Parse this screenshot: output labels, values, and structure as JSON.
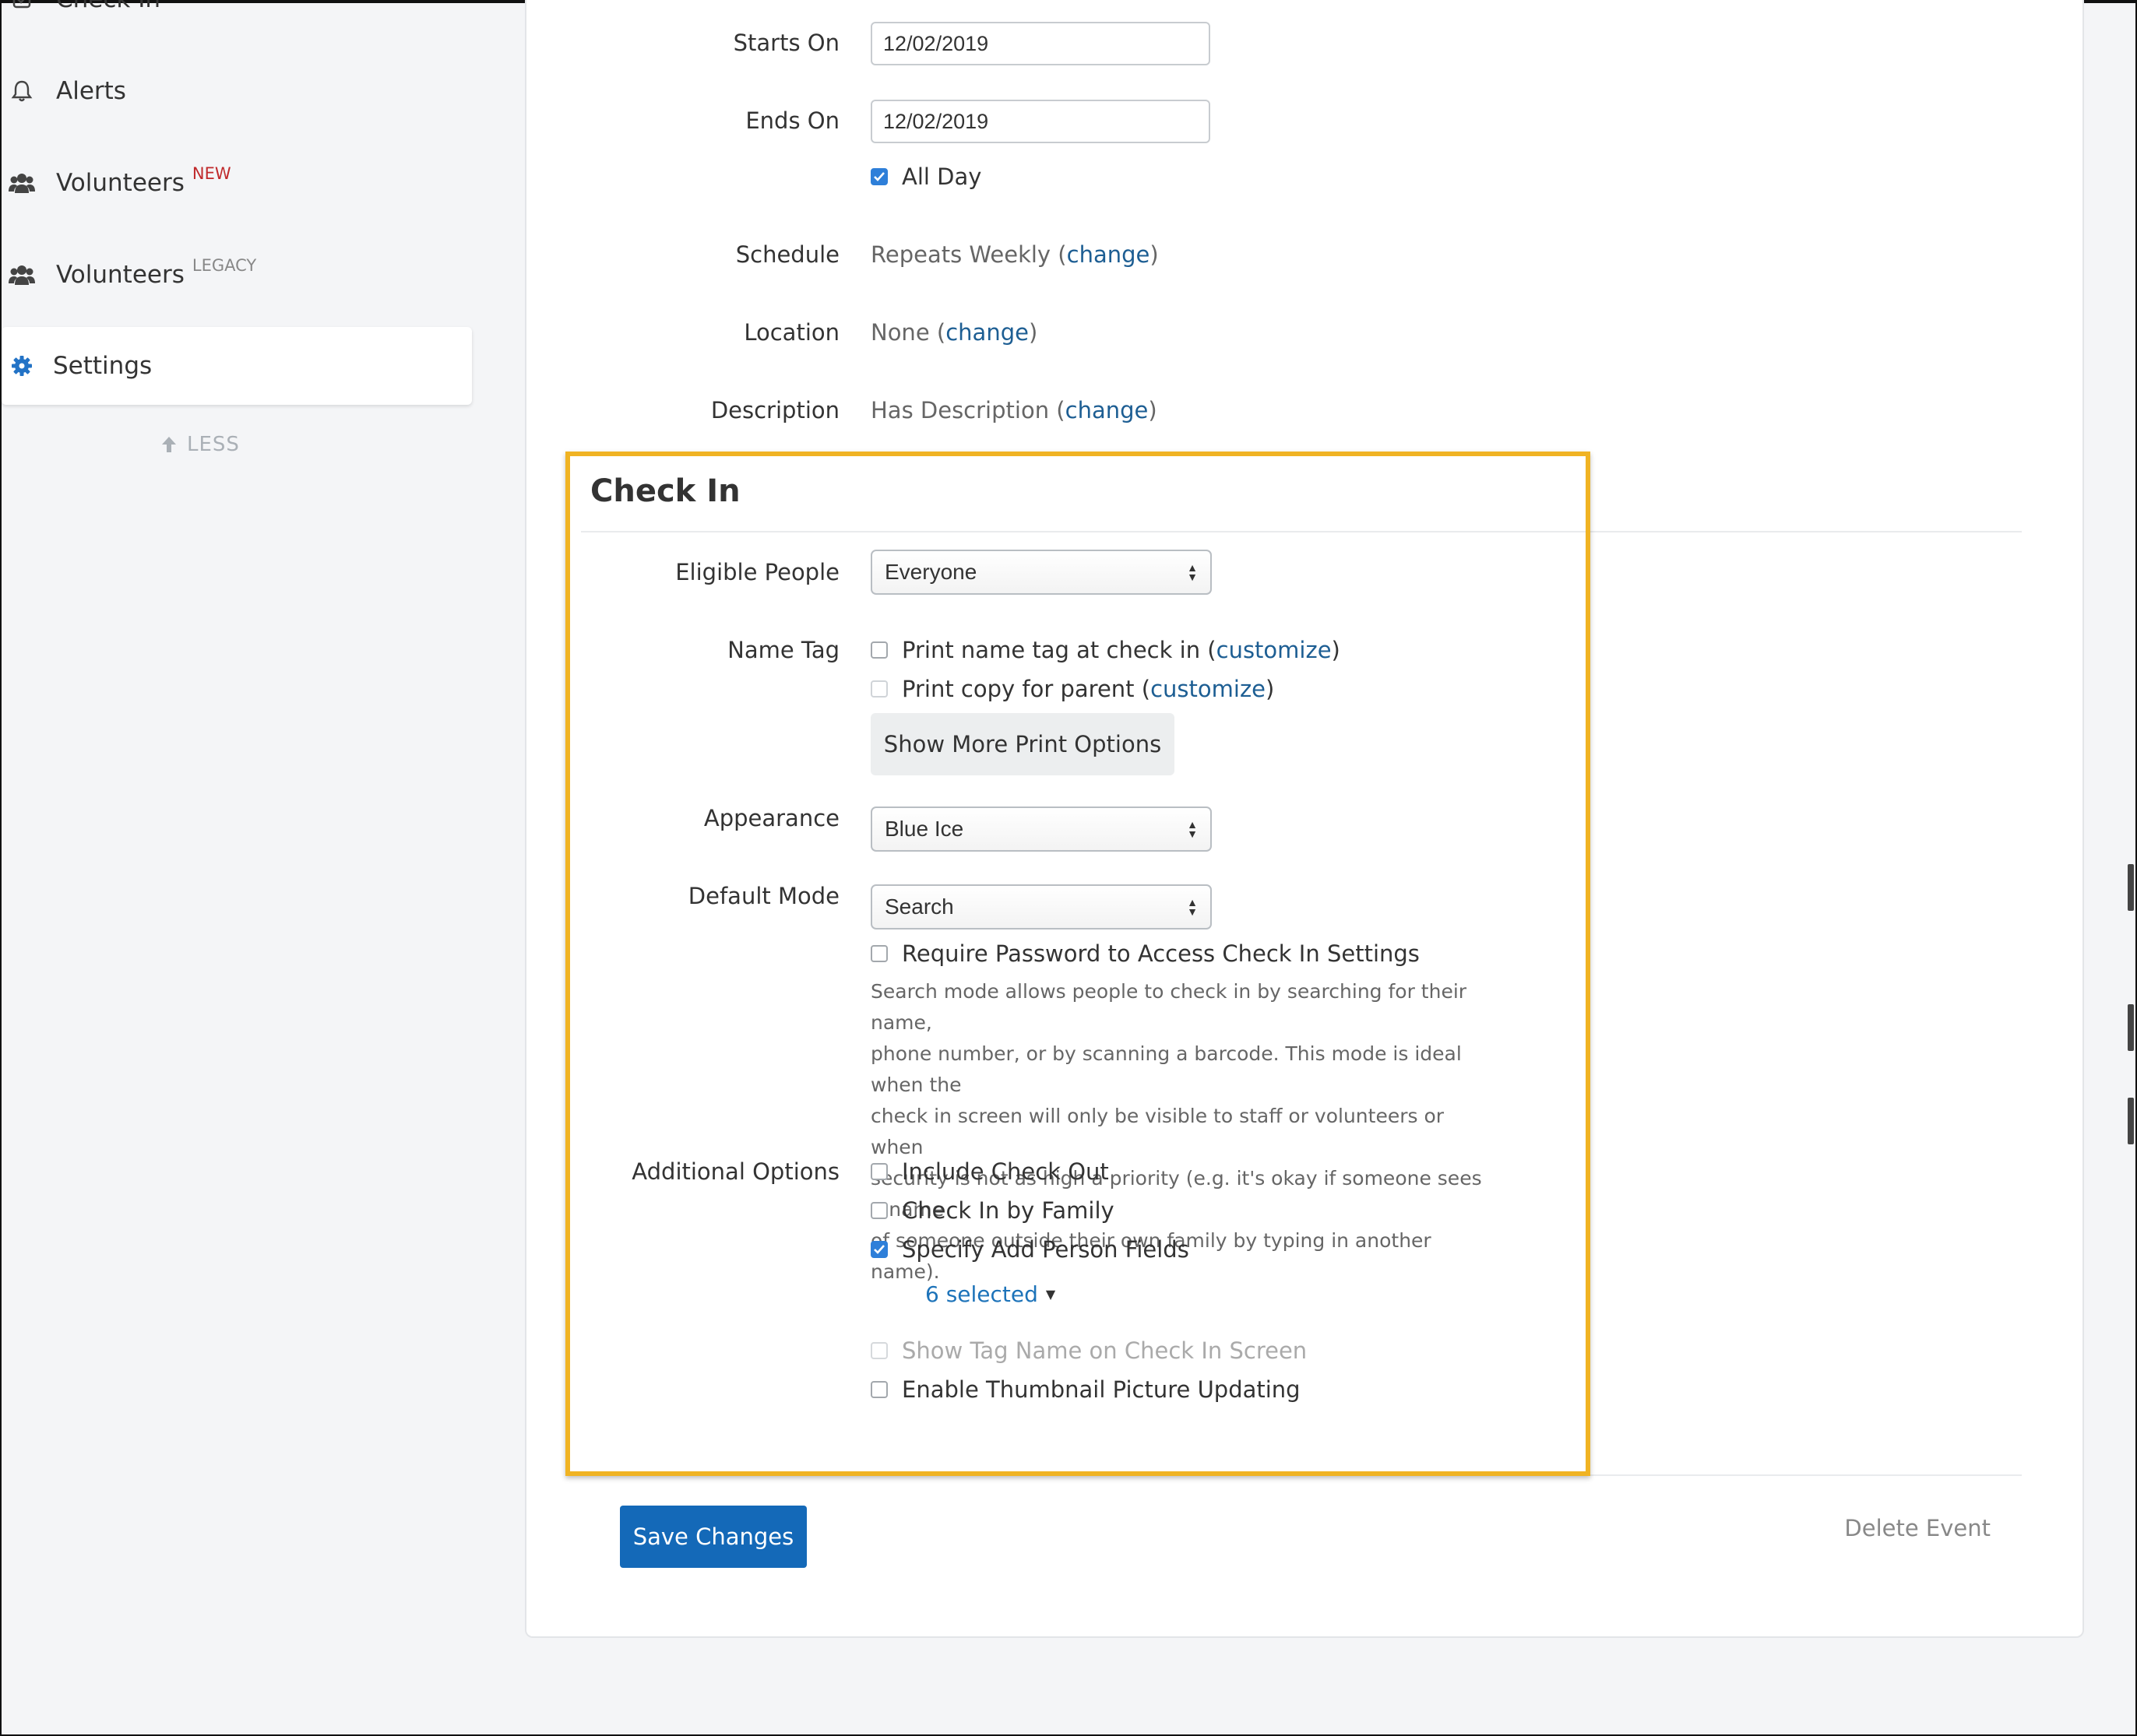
{
  "sidebar": {
    "items": [
      {
        "label": "Check In",
        "icon": "check-in-icon"
      },
      {
        "label": "Alerts",
        "icon": "bell-icon"
      },
      {
        "label": "Volunteers",
        "badge": "NEW",
        "icon": "people-icon"
      },
      {
        "label": "Volunteers",
        "badge": "LEGACY",
        "icon": "people-icon"
      },
      {
        "label": "Settings",
        "icon": "gear-icon",
        "active": true
      }
    ],
    "less_label": "LESS"
  },
  "form": {
    "starts_on": {
      "label": "Starts On",
      "value": "12/02/2019"
    },
    "ends_on": {
      "label": "Ends On",
      "value": "12/02/2019"
    },
    "all_day": {
      "label": "All Day",
      "checked": true
    },
    "schedule": {
      "label": "Schedule",
      "value": "Repeats Weekly",
      "link": "change"
    },
    "location": {
      "label": "Location",
      "value": "None",
      "link": "change"
    },
    "description": {
      "label": "Description",
      "value": "Has Description",
      "link": "change"
    }
  },
  "checkin": {
    "title": "Check In",
    "eligible_people": {
      "label": "Eligible People",
      "value": "Everyone"
    },
    "name_tag": {
      "label": "Name Tag",
      "print_tag": {
        "label": "Print name tag at check in",
        "link": "customize",
        "checked": false
      },
      "print_parent": {
        "label": "Print copy for parent",
        "link": "customize",
        "checked": false
      },
      "more_options_button": "Show More Print Options"
    },
    "appearance": {
      "label": "Appearance",
      "value": "Blue Ice"
    },
    "default_mode": {
      "label": "Default Mode",
      "value": "Search",
      "require_password": {
        "label": "Require Password to Access Check In Settings",
        "checked": false
      },
      "help_lines": [
        "Search mode allows people to check in by searching for their name,",
        "phone number, or by scanning a barcode. This mode is ideal when the",
        "check in screen will only be visible to staff or volunteers or when",
        "security is not as high a priority (e.g. it's okay if someone sees a name",
        "of someone outside their own family by typing in another name)."
      ]
    },
    "additional_options": {
      "label": "Additional Options",
      "include_check_out": {
        "label": "Include Check Out",
        "checked": false
      },
      "check_in_by_family": {
        "label": "Check In by Family",
        "checked": true
      },
      "specify_add_person": {
        "label": "Specify Add Person Fields",
        "checked": true
      },
      "selected_dropdown": "6 selected",
      "show_tag_name": {
        "label": "Show Tag Name on Check In Screen",
        "disabled": true
      },
      "enable_thumbnail": {
        "label": "Enable Thumbnail Picture Updating",
        "checked": false
      }
    }
  },
  "footer": {
    "save_label": "Save Changes",
    "delete_label": "Delete Event"
  },
  "colors": {
    "highlight": "#f0b323",
    "primary": "#1469b8",
    "link": "#1d5e93",
    "badge_new": "#c0292b"
  }
}
